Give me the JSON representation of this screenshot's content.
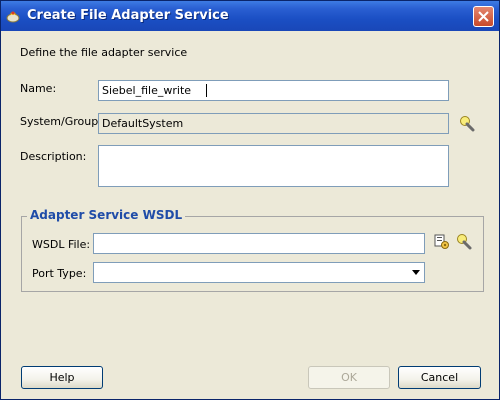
{
  "window": {
    "title": "Create File Adapter Service",
    "icons": {
      "app": "oracle-app-icon",
      "close": "close-icon"
    }
  },
  "intro": "Define the file adapter service",
  "form": {
    "name_label": "Name:",
    "name_value": "Siebel_file_write",
    "system_label": "System/Group:",
    "system_value": "DefaultSystem",
    "description_label": "Description:",
    "description_value": ""
  },
  "wsdl_group": {
    "title": "Adapter Service WSDL",
    "wsdl_file_label": "WSDL File:",
    "wsdl_file_value": "",
    "port_type_label": "Port Type:",
    "port_type_value": ""
  },
  "buttons": {
    "help": "Help",
    "ok": "OK",
    "cancel": "Cancel"
  },
  "icons": {
    "browse_system": "flashlight-browse-icon",
    "service_explorer": "service-explorer-icon",
    "browse_wsdl": "flashlight-browse-icon"
  }
}
